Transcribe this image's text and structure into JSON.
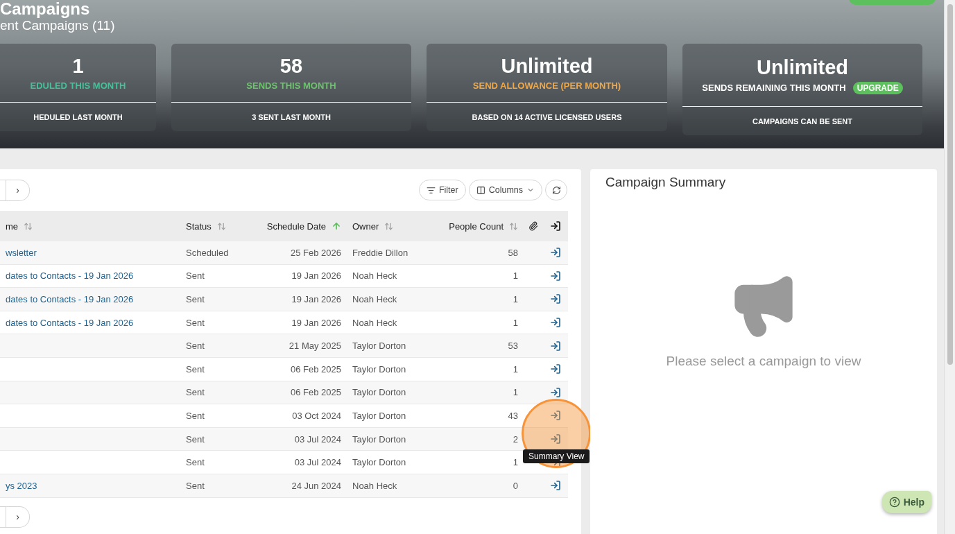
{
  "header": {
    "title": "Campaigns",
    "subtitle": "ent Campaigns (11)"
  },
  "stats": [
    {
      "value": "1",
      "label": "EDULED THIS MONTH",
      "color": "#45c29a",
      "footer": "HEDULED LAST MONTH"
    },
    {
      "value": "58",
      "label": "SENDS THIS MONTH",
      "color": "#6cc46c",
      "footer": "3 SENT LAST MONTH"
    },
    {
      "value": "Unlimited",
      "label": "SEND ALLOWANCE (PER MONTH)",
      "color": "#f0a848",
      "footer": "BASED ON 14 ACTIVE LICENSED USERS"
    },
    {
      "value": "Unlimited",
      "label": "SENDS REMAINING THIS MONTH",
      "color": "#ffffff",
      "badge": "UPGRADE",
      "footer": "CAMPAIGNS CAN BE SENT"
    }
  ],
  "pager": {
    "next": "›"
  },
  "toolbar": {
    "filter": "Filter",
    "columns": "Columns"
  },
  "table": {
    "columns": [
      {
        "kind": "text",
        "label": "me",
        "sorted": false
      },
      {
        "kind": "text",
        "label": "Status",
        "sorted": false
      },
      {
        "kind": "text",
        "label": "Schedule Date",
        "sorted": true
      },
      {
        "kind": "text",
        "label": "Owner",
        "sorted": false
      },
      {
        "kind": "text",
        "label": "People Count",
        "sorted": false
      },
      {
        "kind": "attach"
      },
      {
        "kind": "open"
      }
    ],
    "rows": [
      {
        "name": "wsletter",
        "status": "Scheduled",
        "date": "25 Feb 2026",
        "owner": "Freddie Dillon",
        "count": "58"
      },
      {
        "name": "dates to Contacts - 19 Jan 2026",
        "status": "Sent",
        "date": "19 Jan 2026",
        "owner": "Noah Heck",
        "count": "1"
      },
      {
        "name": "dates to Contacts - 19 Jan 2026",
        "status": "Sent",
        "date": "19 Jan 2026",
        "owner": "Noah Heck",
        "count": "1"
      },
      {
        "name": "dates to Contacts - 19 Jan 2026",
        "status": "Sent",
        "date": "19 Jan 2026",
        "owner": "Noah Heck",
        "count": "1"
      },
      {
        "status": "Sent",
        "date": "21 May 2025",
        "owner": "Taylor Dorton",
        "count": "53"
      },
      {
        "status": "Sent",
        "date": "06 Feb 2025",
        "owner": "Taylor Dorton",
        "count": "1"
      },
      {
        "status": "Sent",
        "date": "06 Feb 2025",
        "owner": "Taylor Dorton",
        "count": "1"
      },
      {
        "status": "Sent",
        "date": "03 Oct 2024",
        "owner": "Taylor Dorton",
        "count": "43"
      },
      {
        "status": "Sent",
        "date": "03 Jul 2024",
        "owner": "Taylor Dorton",
        "count": "2"
      },
      {
        "status": "Sent",
        "date": "03 Jul 2024",
        "owner": "Taylor Dorton",
        "count": "1"
      },
      {
        "name": "ys 2023",
        "status": "Sent",
        "date": "24 Jun 2024",
        "owner": "Noah Heck",
        "count": "0"
      }
    ]
  },
  "tooltip": "Summary View",
  "summary": {
    "title": "Campaign Summary",
    "empty": "Please select a campaign to view"
  },
  "help": "Help"
}
